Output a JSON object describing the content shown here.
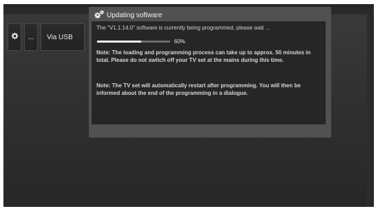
{
  "tabs": {
    "dots_label": "...",
    "usb_label": "Via USB"
  },
  "dialog": {
    "title": "Updating software",
    "message": "The \"V1.1.14.0\" software is currently being programmed, please wait ...",
    "progress_percent": 60,
    "progress_label": "60%",
    "note1": "Note: The loading and programming process can take up to approx. 50 minutes in total. Please do not switch off your TV set at the mains during this time.",
    "note2": "Note: The TV set will automatically restart after programming. You will then be informed about the end of the programming in a dialogue."
  },
  "colors": {
    "dialog_frame": "#515151",
    "dialog_body": "#262626",
    "progress_fill": "#f4f4f4"
  },
  "icons": {
    "title_icon": "gears-icon",
    "tab_icon": "gear-icon"
  }
}
